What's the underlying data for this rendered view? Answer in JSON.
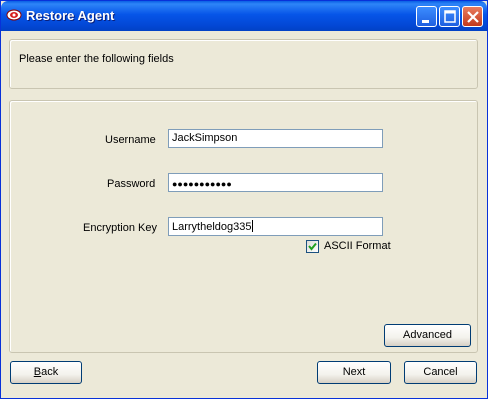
{
  "window": {
    "title": "Restore Agent"
  },
  "header": {
    "instruction": "Please enter the following fields"
  },
  "form": {
    "username_label": "Username",
    "username_value": "JackSimpson",
    "password_label": "Password",
    "password_mask": "●●●●●●●●●●●",
    "encryption_label": "Encryption Key",
    "encryption_value": "Larrytheldog335",
    "ascii_label": "ASCII Format",
    "ascii_checked": true
  },
  "buttons": {
    "advanced": "Advanced",
    "back_prefix": "B",
    "back_rest": "ack",
    "next": "Next",
    "cancel": "Cancel"
  },
  "colors": {
    "titlebar": "#0A5FE5",
    "face": "#ECE9D8",
    "check": "#21A121"
  }
}
